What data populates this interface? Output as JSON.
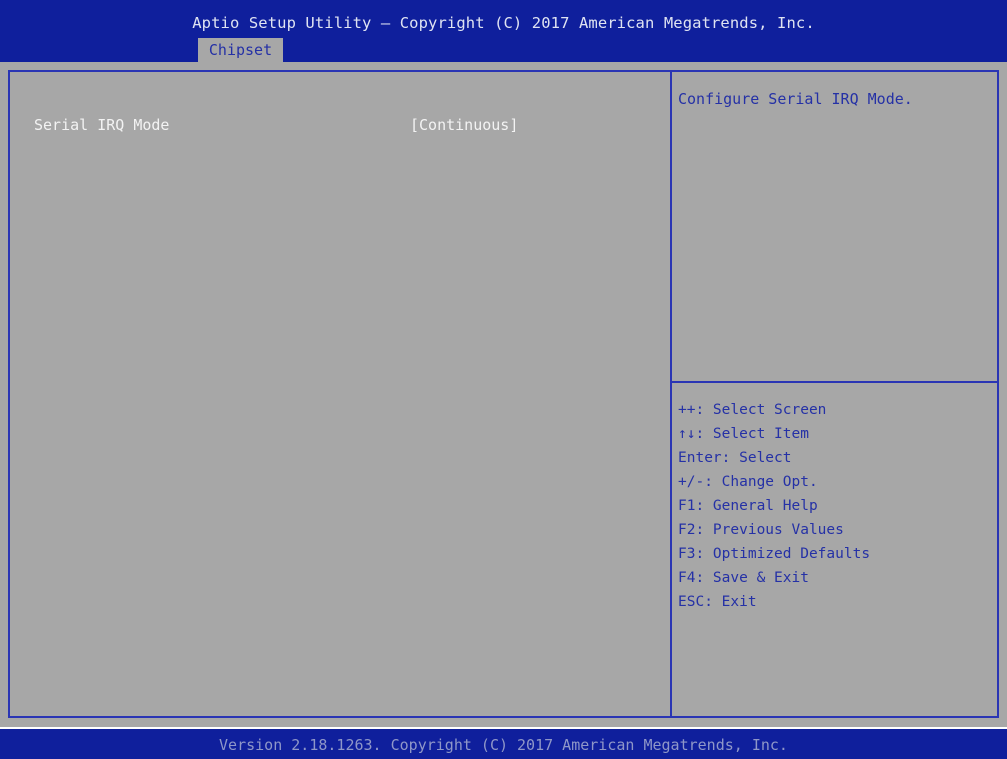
{
  "header": {
    "title": "Aptio Setup Utility – Copyright (C) 2017 American Megatrends, Inc.",
    "active_tab": "Chipset"
  },
  "settings": {
    "items": [
      {
        "label": "Serial IRQ Mode",
        "value": "[Continuous]"
      }
    ]
  },
  "help": {
    "description": "Configure Serial IRQ Mode.",
    "keys": [
      "++: Select Screen",
      "↑↓: Select Item",
      "Enter: Select",
      "+/-: Change Opt.",
      "F1: General Help",
      "F2: Previous Values",
      "F3: Optimized Defaults",
      "F4: Save & Exit",
      "ESC: Exit"
    ]
  },
  "footer": {
    "version": "Version 2.18.1263. Copyright (C) 2017 American Megatrends, Inc."
  },
  "colors": {
    "header_bg": "#0f1f9c",
    "body_bg": "#a7a7a7",
    "accent_text": "#2531a6",
    "item_text": "#f3f3f3",
    "frame_line": "#2a35b4"
  }
}
